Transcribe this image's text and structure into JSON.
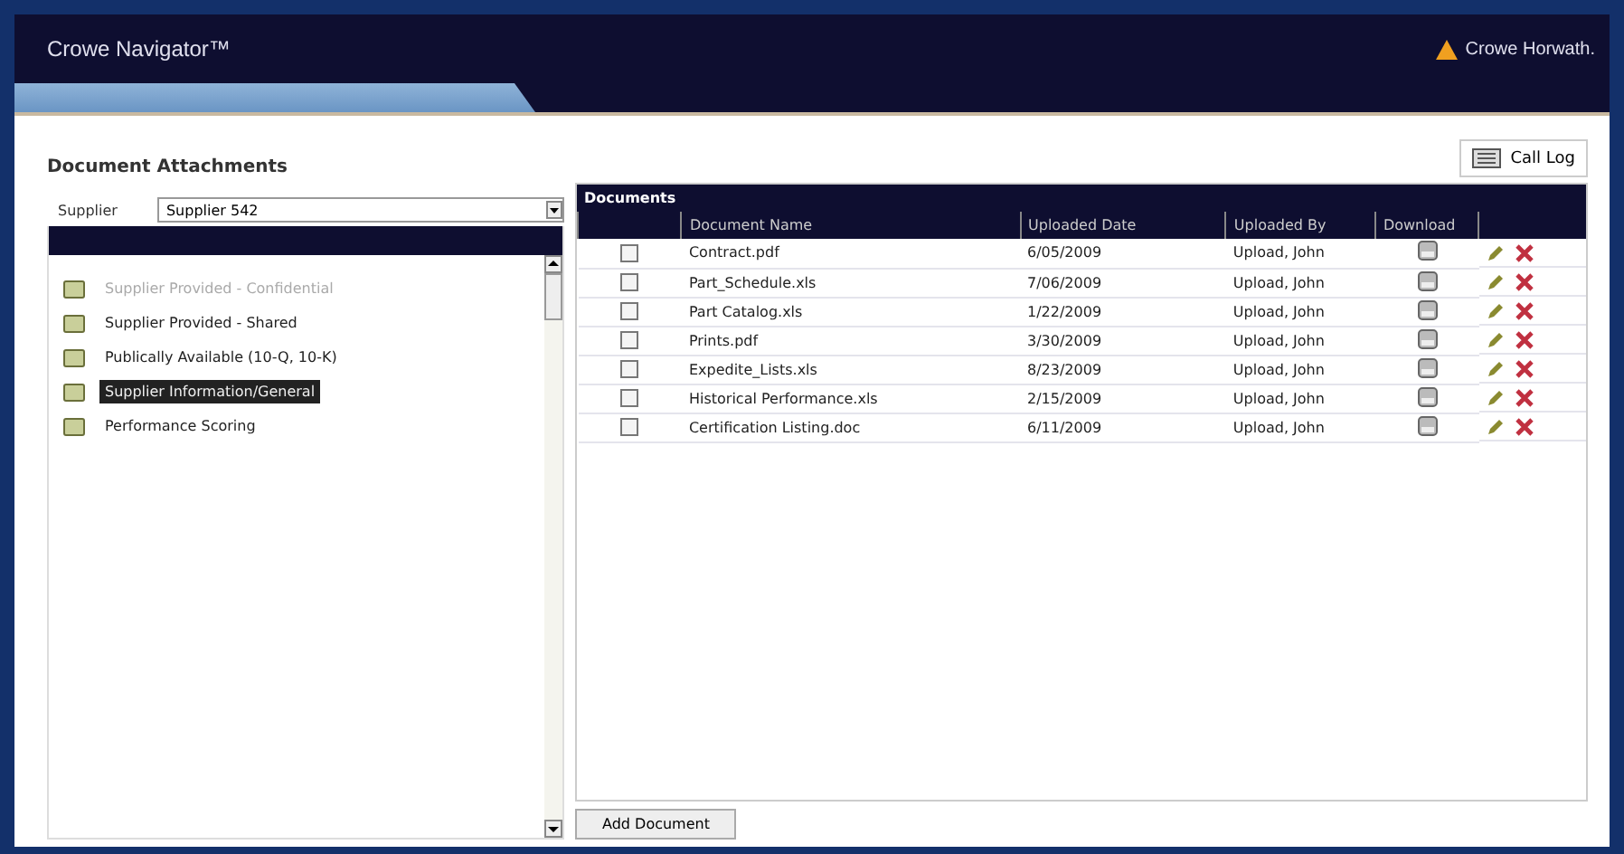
{
  "header": {
    "title": "Crowe Navigator™",
    "brand": "Crowe Horwath."
  },
  "page": {
    "title": "Document Attachments",
    "call_log": "Call Log"
  },
  "supplier": {
    "label": "Supplier",
    "value": "Supplier 542"
  },
  "tree": [
    {
      "label": "Supplier Provided - Confidential",
      "disabled": true,
      "selected": false
    },
    {
      "label": "Supplier Provided - Shared",
      "disabled": false,
      "selected": false
    },
    {
      "label": "Publically Available (10-Q, 10-K)",
      "disabled": false,
      "selected": false
    },
    {
      "label": "Supplier Information/General",
      "disabled": false,
      "selected": true
    },
    {
      "label": "Performance Scoring",
      "disabled": false,
      "selected": false
    }
  ],
  "documents": {
    "title": "Documents",
    "columns": [
      "Document Name",
      "Uploaded Date",
      "Uploaded By",
      "Download"
    ],
    "rows": [
      {
        "checked": false,
        "name": "Contract.pdf",
        "date": "6/05/2009",
        "by": "Upload, John"
      },
      {
        "checked": false,
        "name": "Part_Schedule.xls",
        "date": "7/06/2009",
        "by": "Upload, John"
      },
      {
        "checked": false,
        "name": "Part Catalog.xls",
        "date": "1/22/2009",
        "by": "Upload, John"
      },
      {
        "checked": false,
        "name": "Prints.pdf",
        "date": "3/30/2009",
        "by": "Upload, John"
      },
      {
        "checked": false,
        "name": "Expedite_Lists.xls",
        "date": "8/23/2009",
        "by": "Upload, John"
      },
      {
        "checked": false,
        "name": "Historical Performance.xls",
        "date": "2/15/2009",
        "by": "Upload, John"
      },
      {
        "checked": false,
        "name": "Certification Listing.doc",
        "date": "6/11/2009",
        "by": "Upload, John"
      }
    ],
    "add_button": "Add Document"
  }
}
